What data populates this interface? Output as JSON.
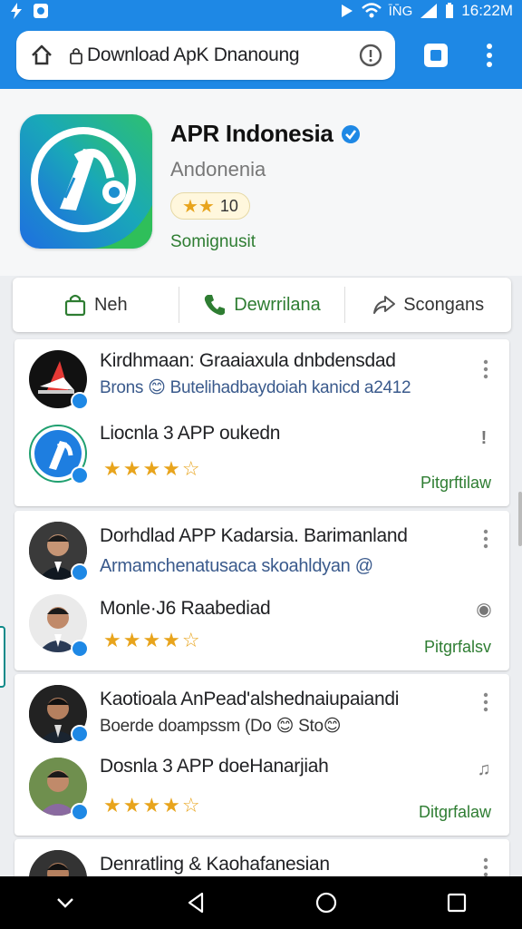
{
  "status_bar": {
    "time": "16:22M",
    "signal_text": "ĪN̄G"
  },
  "browser": {
    "url_text": "Download ApK Dnanoung",
    "home_icon": "home-icon",
    "lock_icon": "lock-icon",
    "info_icon": "info-icon",
    "tab_icon": "tab-switcher-icon",
    "menu_icon": "kebab-menu-icon",
    "accent": "#1e88e5"
  },
  "app": {
    "title": "APR Indonesia",
    "subtitle": "Andonenia",
    "rating_value": "10",
    "rating_stars": "★★",
    "link_text": "Somignusit"
  },
  "actions": [
    {
      "label": "Neh",
      "icon": "bag-icon"
    },
    {
      "label": "Dewrrilana",
      "icon": "phone-icon"
    },
    {
      "label": "Scongans",
      "icon": "share-icon"
    }
  ],
  "cards": [
    {
      "items": [
        {
          "title": "Kirdhmaan: Graaiaxula dnbdensdad",
          "sub": "Brons 😊 Butelihadbaydoiah kanicd a2412",
          "icon": "kebab-menu-icon"
        },
        {
          "title": "Liocnla 3 APP oukedn",
          "stars": "★★★★☆",
          "action": "Pitgrftilaw",
          "icon": "exclamation-icon"
        }
      ]
    },
    {
      "items": [
        {
          "title": "Dorhdlad APP Kadarsia. Barimanland",
          "sub": "Armamchenatusaca skoahldyan @",
          "icon": "kebab-menu-icon"
        },
        {
          "title": "Monle·J6 Raabediad",
          "stars": "★★★★☆",
          "action": "Pitgrfalsv",
          "icon": "drop-icon"
        }
      ]
    },
    {
      "items": [
        {
          "title": "Kaotioala AnPead'alshednaiupaiandi",
          "sub": "Boerde doampssm (Do 😊 Sto😊",
          "icon": "kebab-menu-icon"
        },
        {
          "title": "Dosnla 3 APP doeHanarjiah",
          "stars": "★★★★☆",
          "action": "Ditgrfalaw",
          "icon": "bell-icon"
        }
      ]
    },
    {
      "items": [
        {
          "title": "Denratling & Kaohafanesian",
          "icon": "kebab-menu-icon"
        }
      ]
    }
  ],
  "nav": {
    "back_icon": "back-icon",
    "home_icon": "circle-home-icon",
    "recents_icon": "recents-icon",
    "down_icon": "chevron-down-icon"
  }
}
